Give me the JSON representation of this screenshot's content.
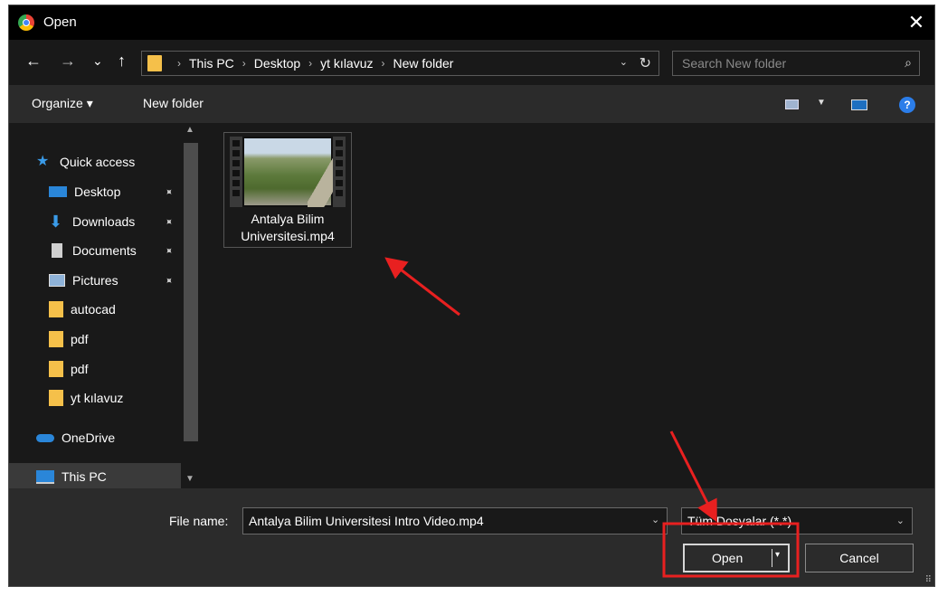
{
  "window": {
    "title": "Open",
    "close_glyph": "✕"
  },
  "nav": {
    "back_glyph": "←",
    "forward_glyph": "→",
    "recent_glyph": "⌄",
    "up_glyph": "↑",
    "breadcrumb": [
      "This PC",
      "Desktop",
      "yt kılavuz",
      "New folder"
    ],
    "breadcrumb_sep": "›",
    "refresh_glyph": "↻",
    "dropdown_glyph": "⌄"
  },
  "search": {
    "placeholder": "Search New folder",
    "icon_glyph": "⌕"
  },
  "toolbar": {
    "organize_label": "Organize ▾",
    "new_folder_label": "New folder",
    "help_glyph": "?"
  },
  "sidebar": {
    "items": [
      {
        "label": "Quick access",
        "icon": "star-icon",
        "color": "#3a9be8"
      },
      {
        "label": "Desktop",
        "icon": "desktop-icon",
        "color": "#2a86d9",
        "pinned": true
      },
      {
        "label": "Downloads",
        "icon": "download-icon",
        "color": "#3a9be8",
        "pinned": true
      },
      {
        "label": "Documents",
        "icon": "document-icon",
        "color": "#d0d0d0",
        "pinned": true
      },
      {
        "label": "Pictures",
        "icon": "picture-icon",
        "color": "#8fb3d9",
        "pinned": true
      },
      {
        "label": "autocad",
        "icon": "folder-icon",
        "color": "#f5c04a"
      },
      {
        "label": "pdf",
        "icon": "folder-icon",
        "color": "#f5c04a"
      },
      {
        "label": "pdf",
        "icon": "folder-icon",
        "color": "#f5c04a"
      },
      {
        "label": "yt kılavuz",
        "icon": "folder-icon",
        "color": "#f5c04a"
      },
      {
        "label": "OneDrive",
        "icon": "cloud-icon",
        "color": "#2a86d9"
      },
      {
        "label": "This PC",
        "icon": "computer-icon",
        "color": "#2a86d9",
        "selected": true
      }
    ],
    "pin_glyph": "📌"
  },
  "files": [
    {
      "name": "Antalya Bilim Universitesi.mp4",
      "type": "video"
    }
  ],
  "file_display": {
    "line1": "Antalya Bilim",
    "line2": "Universitesi.mp4"
  },
  "bottom": {
    "file_name_label": "File name:",
    "file_name_value": "Antalya Bilim Universitesi Intro Video.mp4",
    "file_type_value": "Tüm Dosyalar (*.*)",
    "dropdown_glyph": "⌄",
    "open_label": "Open",
    "open_arrow_glyph": "▾",
    "cancel_label": "Cancel",
    "grip_glyph": "⠿"
  },
  "colors": {
    "background": "#191919",
    "panel": "#2b2b2b",
    "titlebar": "#000000",
    "annotation": "#e82020",
    "folder": "#f5c04a"
  }
}
